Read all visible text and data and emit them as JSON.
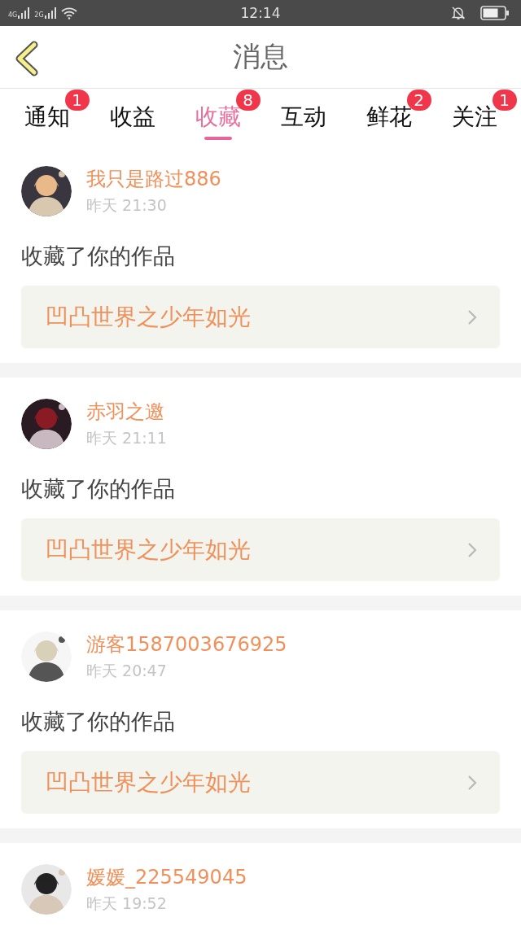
{
  "status_bar": {
    "networks": [
      "4G",
      "2G"
    ],
    "time": "12:14"
  },
  "header": {
    "title": "消息"
  },
  "tabs": [
    {
      "label": "通知",
      "selected": false,
      "badge": "1"
    },
    {
      "label": "收益",
      "selected": false
    },
    {
      "label": "收藏",
      "selected": true,
      "badge": "8"
    },
    {
      "label": "互动",
      "selected": false
    },
    {
      "label": "鲜花",
      "selected": false,
      "badge": "2"
    },
    {
      "label": "关注",
      "selected": false,
      "badge": "1"
    }
  ],
  "messages": [
    {
      "user": "我只是路过886",
      "time": "昨天 21:30",
      "action": "收藏了你的作品",
      "work": "凹凸世界之少年如光"
    },
    {
      "user": "赤羽之邀",
      "time": "昨天 21:11",
      "action": "收藏了你的作品",
      "work": "凹凸世界之少年如光"
    },
    {
      "user": "游客1587003676925",
      "time": "昨天 20:47",
      "action": "收藏了你的作品",
      "work": "凹凸世界之少年如光"
    },
    {
      "user": "媛媛_225549045",
      "time": "昨天 19:52"
    }
  ]
}
